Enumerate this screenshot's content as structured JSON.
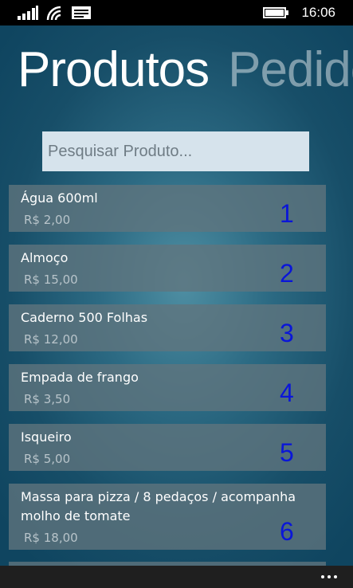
{
  "status_bar": {
    "time": "16:06",
    "icons": [
      "signal-icon",
      "wifi-icon",
      "message-icon",
      "battery-icon"
    ]
  },
  "pivot": {
    "tabs": [
      {
        "label": "Produtos",
        "active": true
      },
      {
        "label": "Pedidos",
        "active": false
      }
    ]
  },
  "search": {
    "placeholder": "Pesquisar Produto...",
    "value": ""
  },
  "products": [
    {
      "name": "Água 600ml",
      "price": "R$ 2,00",
      "number": "1"
    },
    {
      "name": "Almoço",
      "price": "R$ 15,00",
      "number": "2"
    },
    {
      "name": "Caderno 500 Folhas",
      "price": "R$ 12,00",
      "number": "3"
    },
    {
      "name": "Empada de frango",
      "price": "R$ 3,50",
      "number": "4"
    },
    {
      "name": "Isqueiro",
      "price": "R$ 5,00",
      "number": "5"
    },
    {
      "name": "Massa para pizza / 8 pedaços / acompanha molho de tomate",
      "price": "R$ 18,00",
      "number": "6"
    }
  ],
  "colors": {
    "number": "#0a16d8",
    "item_bg": "#60747e",
    "search_bg": "#d6e3ec"
  },
  "app_bar": {
    "more_icon": "ellipsis-icon"
  }
}
